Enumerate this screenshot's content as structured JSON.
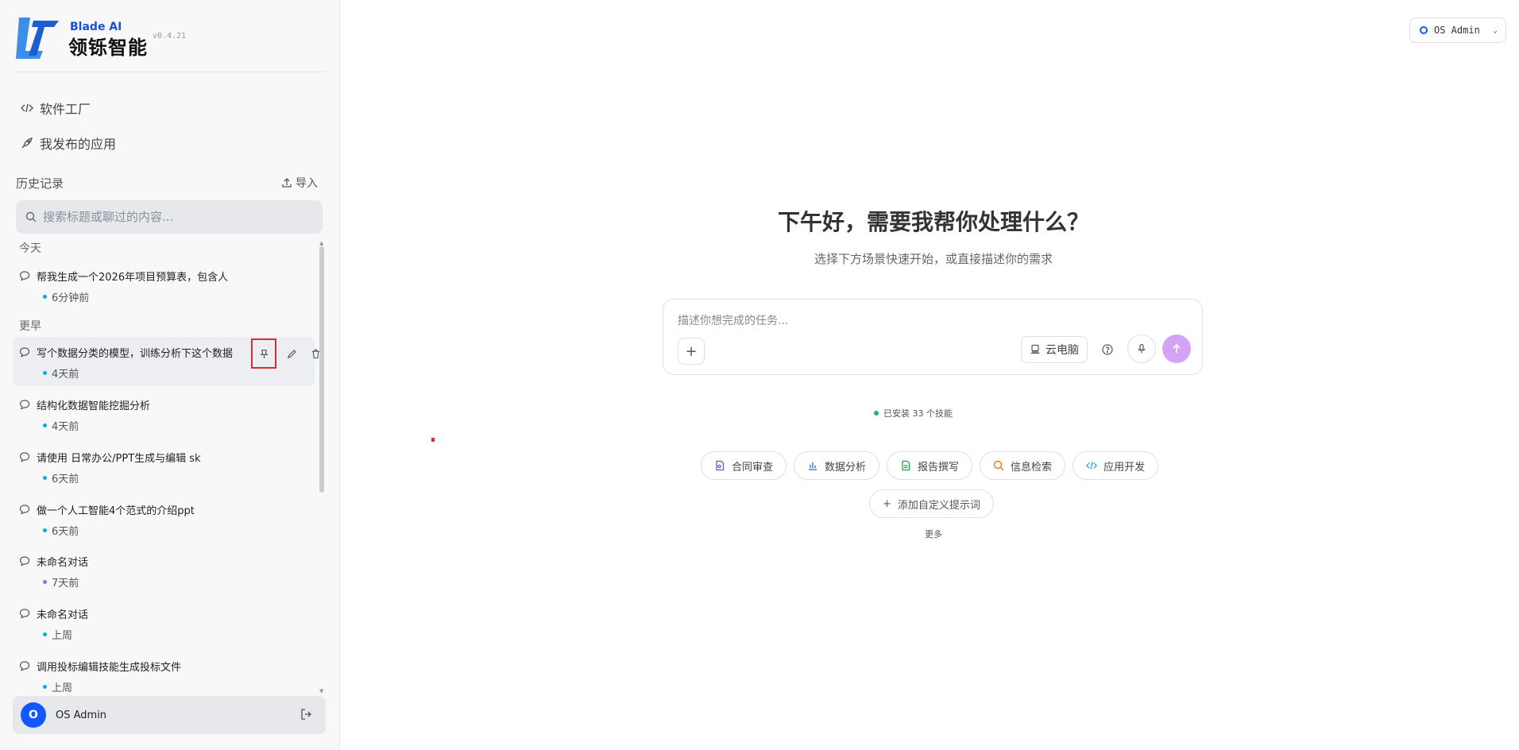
{
  "brand": {
    "name_en": "Blade AI",
    "name_cn": "领铄智能",
    "version": "v0.4.21"
  },
  "nav": [
    {
      "label": "软件工厂",
      "icon": "code-icon"
    },
    {
      "label": "我发布的应用",
      "icon": "rocket-icon"
    }
  ],
  "history": {
    "title": "历史记录",
    "import_label": "导入",
    "search_placeholder": "搜索标题或聊过的内容...",
    "groups": [
      {
        "label": "今天"
      },
      {
        "label": "更早"
      }
    ],
    "items": [
      {
        "title": "帮我生成一个2026年项目预算表，包含人",
        "time": "6分钟前",
        "dot_color": "#1aa6d9"
      },
      {
        "title": "写个数据分类的模型，训练分析下这个数据",
        "time": "4天前",
        "dot_color": "#1aa6d9"
      },
      {
        "title": "结构化数据智能挖掘分析",
        "time": "4天前",
        "dot_color": "#1aa6d9"
      },
      {
        "title": "请使用 日常办公/PPT生成与编辑 sk",
        "time": "6天前",
        "dot_color": "#1aa6d9"
      },
      {
        "title": "做一个人工智能4个范式的介绍ppt",
        "time": "6天前",
        "dot_color": "#1aa6d9"
      },
      {
        "title": "未命名对话",
        "time": "7天前",
        "dot_color": "#9b6be0"
      },
      {
        "title": "未命名对话",
        "time": "上周",
        "dot_color": "#1aa6d9"
      },
      {
        "title": "调用投标编辑技能生成投标文件",
        "time": "上周",
        "dot_color": "#1aa6d9"
      }
    ]
  },
  "user": {
    "name": "OS Admin",
    "initial": "O"
  },
  "topbar": {
    "user_label": "OS Admin"
  },
  "main": {
    "greeting": "下午好，需要我帮你处理什么？",
    "subtitle": "选择下方场景快速开始，或直接描述你的需求",
    "input_placeholder": "描述你想完成的任务...",
    "cloud_label": "云电脑",
    "skills_text": "已安装 33 个技能",
    "chips": [
      {
        "label": "合同审查",
        "icon": "document-icon",
        "color": "#7b52c7"
      },
      {
        "label": "数据分析",
        "icon": "bar-chart-icon",
        "color": "#2563eb"
      },
      {
        "label": "报告撰写",
        "icon": "report-icon",
        "color": "#16a34a"
      },
      {
        "label": "信息检索",
        "icon": "search-icon",
        "color": "#ea7a1c"
      },
      {
        "label": "应用开发",
        "icon": "code-icon",
        "color": "#0ea5e9"
      }
    ],
    "add_prompt_label": "添加自定义提示词",
    "more_label": "更多"
  },
  "colors": {
    "accent": "#1456ff",
    "send": "#d3a4f6",
    "active_row": "#eceef2",
    "highlight": "#d32f2f"
  }
}
